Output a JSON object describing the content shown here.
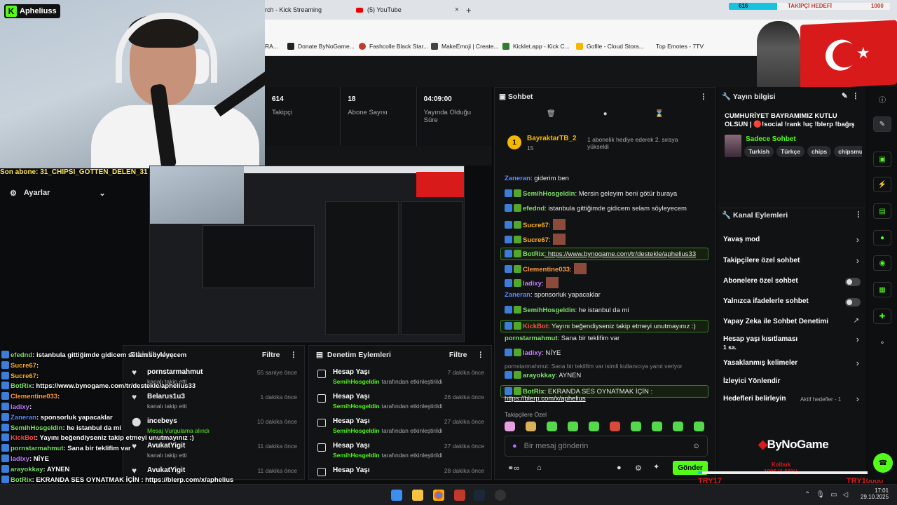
{
  "browser": {
    "tabs": [
      {
        "label": "rch - Kick Streaming"
      },
      {
        "label": "(5) YouTube"
      }
    ],
    "new_tab": "+",
    "bookmarks": [
      "RA...",
      "Donate ByNoGame...",
      "Fashcolle Black Star...",
      "MakeEmoji | Create...",
      "Kicklet.app - Kick C...",
      "Gofile - Cloud Stora...",
      "Top Emotes - 7TV"
    ]
  },
  "overlay": {
    "follower_count": "616",
    "follower_goal_label": "TAKİPÇİ HEDEFİ",
    "follower_goal": "1000",
    "try_left": "TRY17",
    "try_right": "TRY10000",
    "goal_sub": "Kolbuk",
    "goal_pct": "199$ (1.66%)"
  },
  "cam": {
    "name": "Apheliuss"
  },
  "stats": [
    {
      "value": "614",
      "label": "Takipçi"
    },
    {
      "value": "18",
      "label": "Abone Sayısı"
    },
    {
      "value": "04:09:00",
      "label": "Yayında Olduğu Süre"
    }
  ],
  "ticker": "Son abone: 31_CHIPSI_GOTTEN_DELEN_31",
  "settings": {
    "label": "Ayarlar"
  },
  "activity": {
    "title": "Etkinlik Akışı",
    "filter": "Filtre",
    "items": [
      {
        "title": "pornstarmahmut",
        "sub": "kanalı takip etti",
        "time": "55 saniye önce"
      },
      {
        "title": "Belarus1u3",
        "sub": "kanalı takip etti",
        "time": "1 dakika önce"
      },
      {
        "title": "incebeys",
        "sub": "Mesaj Vurgulama alındı",
        "time": "10 dakika önce"
      },
      {
        "title": "AvukatYigit",
        "sub": "kanalı takip etti",
        "time": "11 dakika önce"
      },
      {
        "title": "AvukatYigit",
        "sub": "",
        "time": "11 dakika önce"
      }
    ]
  },
  "moderation": {
    "title": "Denetim Eylemleri",
    "filter": "Filtre",
    "items": [
      {
        "title": "Hesap Yaşı",
        "user": "SemihHosgeldin",
        "sub": "tarafından etkinleştirildi",
        "time": "7 dakika önce"
      },
      {
        "title": "Hesap Yaşı",
        "user": "SemihHosgeldin",
        "sub": "tarafından etkinleştirildi",
        "time": "26 dakika önce"
      },
      {
        "title": "Hesap Yaşı",
        "user": "SemihHosgeldin",
        "sub": "tarafından etkinleştirildi",
        "time": "27 dakika önce"
      },
      {
        "title": "Hesap Yaşı",
        "user": "SemihHosgeldin",
        "sub": "tarafından etkinleştirildi",
        "time": "27 dakika önce"
      },
      {
        "title": "Hesap Yaşı",
        "user": "",
        "sub": "",
        "time": "28 dakika önce"
      }
    ]
  },
  "left_chat": [
    {
      "user": "efednd",
      "text": ": istanbula gittiğimde gidicem selam söyleyecem",
      "color": "#7ee06a"
    },
    {
      "user": "Sucre67",
      "text": ":",
      "color": "#ffb020"
    },
    {
      "user": "Sucre67",
      "text": ":",
      "color": "#ffb020"
    },
    {
      "user": "BotRix",
      "text": ": https://www.bynogame.com/tr/destekle/aphelius33",
      "color": "#7ee06a"
    },
    {
      "user": "Clementine033",
      "text": ":",
      "color": "#ff9a3c"
    },
    {
      "user": "ladixy",
      "text": ":",
      "color": "#c07bff"
    },
    {
      "user": "Zaneran",
      "text": ": sponsorluk yapacaklar",
      "color": "#5b8bff"
    },
    {
      "user": "SemihHosgeldin",
      "text": ": he istanbul da mi",
      "color": "#7ee06a"
    },
    {
      "user": "KickBot",
      "text": ": Yayını beğendiyseniz takip etmeyi unutmayınız :)",
      "color": "#ff4d4d"
    },
    {
      "user": "pornstarmahmut",
      "text": ": Sana bir teklifim var",
      "color": "#7ee06a"
    },
    {
      "user": "ladixy",
      "text": ": NİYE",
      "color": "#c07bff"
    },
    {
      "user": "arayokkay",
      "text": ": AYNEN",
      "color": "#7ee06a"
    },
    {
      "user": "BotRix",
      "text": ": EKRANDA SES OYNATMAK İÇİN : https://blerp.com/x/aphelius",
      "color": "#7ee06a"
    }
  ],
  "chat": {
    "title": "Sohbet",
    "pinned_user": "BayraktarTB_2",
    "pinned_count": "15",
    "pinned_text": "1 abonelik hediye ederek 2. sıraya yükseldi",
    "messages": [
      {
        "user": "Zaneran",
        "text": ": giderim ben",
        "color": "#5b8bff"
      },
      {
        "user": "SemihHosgeldin",
        "text": ": Mersin geleyim beni götür buraya",
        "color": "#7ee06a"
      },
      {
        "user": "efednd",
        "text": ": istanbula gittiğimde gidicem selam söyleyecem",
        "color": "#7ee06a"
      },
      {
        "user": "Sucre67",
        "text": ":",
        "color": "#ffb020"
      },
      {
        "user": "Sucre67",
        "text": ":",
        "color": "#ffb020"
      },
      {
        "user": "BotRix",
        "text": ": https://www.bynogame.com/tr/destekle/aphelius33",
        "color": "#7ee06a"
      },
      {
        "user": "Clementine033",
        "text": ":",
        "color": "#ff9a3c"
      },
      {
        "user": "ladixy",
        "text": ":",
        "color": "#c07bff"
      },
      {
        "user": "Zaneran",
        "text": ": sponsorluk yapacaklar",
        "color": "#5b8bff"
      },
      {
        "user": "SemihHosgeldin",
        "text": ": he istanbul da mi",
        "color": "#7ee06a"
      },
      {
        "user": "KickBot",
        "text": ": Yayını beğendiyseniz takip etmeyi unutmayınız :)",
        "color": "#ff4d4d"
      },
      {
        "user": "pornstarmahmut",
        "text": ": Sana bir teklifim var",
        "color": "#7ee06a"
      },
      {
        "user": "ladixy",
        "text": ": NİYE",
        "color": "#c07bff"
      },
      {
        "user": "arayokkay",
        "text": ": AYNEN",
        "color": "#7ee06a"
      },
      {
        "user": "BotRix",
        "text": ": EKRANDA SES OYNATMAK İÇİN :",
        "color": "#7ee06a"
      }
    ],
    "reply_hint": "pornstarmahmut: Sana bir teklifim var isimli kullanıcıya yanıt veriyor",
    "botrix_link": "https://blerp.com/x/aphelius",
    "emote_label": "Takipçilere Özel",
    "input_placeholder": "Bir mesaj gönderin",
    "send": "Gönder"
  },
  "info": {
    "title": "Yayın bilgisi",
    "stream_title": "CUMHURİYET BAYRAMIMIZ KUTLU OLSUN | 🔴!social !rank !uç !blerp !bağış",
    "category": "Sadece Sohbet",
    "tags": [
      "Turkish",
      "Türkçe",
      "chips",
      "chipsmu"
    ]
  },
  "actions": {
    "title": "Kanal Eylemleri",
    "items": [
      {
        "label": "Yavaş mod",
        "kind": "chev"
      },
      {
        "label": "Takipçilere özel sohbet",
        "kind": "chev"
      },
      {
        "label": "Abonelere özel sohbet",
        "kind": "toggle"
      },
      {
        "label": "Yalnızca ifadelerle sohbet",
        "kind": "toggle"
      },
      {
        "label": "Yapay Zeka ile Sohbet Denetimi",
        "kind": "ext"
      },
      {
        "label": "Hesap yaşı kısıtlaması",
        "kind": "chev",
        "sub": "1 sa."
      },
      {
        "label": "Yasaklanmış kelimeler",
        "kind": "chev"
      },
      {
        "label": "İzleyici Yönlendir",
        "kind": "none"
      },
      {
        "label": "Hedefleri belirleyin",
        "kind": "chev",
        "note": "Aktif hedefler - 1"
      }
    ]
  },
  "brand": "ByNoGame",
  "clock": {
    "time": "17:01",
    "date": "29.10.2025"
  }
}
